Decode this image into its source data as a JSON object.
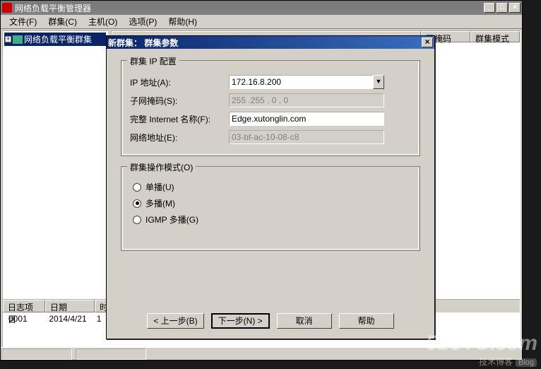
{
  "mainWindow": {
    "title": "网络负载平衡管理器",
    "menus": [
      "文件(F)",
      "群集(C)",
      "主机(O)",
      "选项(P)",
      "帮助(H)"
    ],
    "tree": {
      "root": "网络负载平衡群集"
    },
    "cols": [
      "网掩码",
      "群集模式"
    ],
    "log": {
      "headers": [
        "日志项目",
        "日期",
        "时"
      ],
      "row": {
        "id": "0001",
        "date": "2014/4/21",
        "time": "1"
      }
    }
  },
  "dialog": {
    "title": "新群集：  群集参数",
    "gb1": {
      "title": "群集 IP 配置",
      "ip_label": "IP 地址(A):",
      "ip_value": "172.16.8.200",
      "mask_label": "子网掩码(S):",
      "mask_value": "255 .255 .  0  .  0",
      "fqdn_label": "完整 Internet 名称(F):",
      "fqdn_value": "Edge.xutonglin.com",
      "mac_label": "网络地址(E):",
      "mac_value": "03-bf-ac-10-08-c8"
    },
    "gb2": {
      "title": "群集操作模式(O)",
      "opt1": "单播(U)",
      "opt2": "多播(M)",
      "opt3": "IGMP 多播(G)",
      "selected": "opt2"
    },
    "buttons": {
      "back": "< 上一步(B)",
      "next": "下一步(N) >",
      "cancel": "取消",
      "help": "帮助"
    }
  },
  "watermark": {
    "big": "51CTO.com",
    "small": "技术博客",
    "blog": "Blog"
  }
}
